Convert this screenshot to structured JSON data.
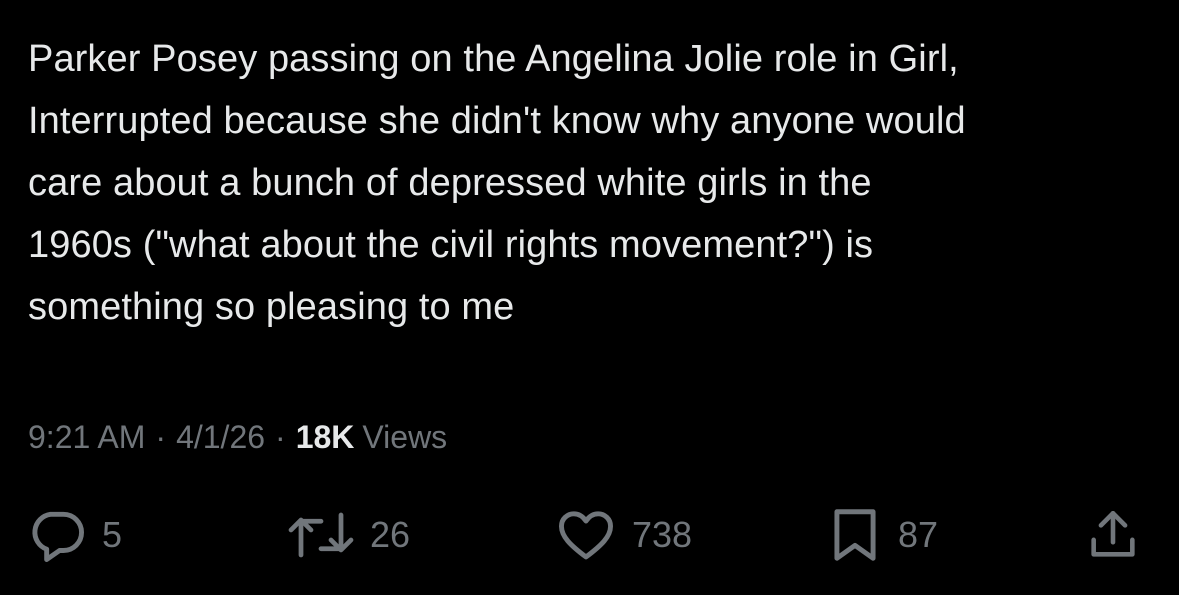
{
  "tweet": {
    "lines": [
      "Parker Posey passing on the Angelina Jolie role in Girl,",
      "Interrupted because she didn't know why anyone would",
      "care about a bunch of depressed white girls in the",
      "1960s (\"what about the civil rights movement?\") is",
      "something so pleasing to me"
    ]
  },
  "meta": {
    "time": "9:21 AM",
    "separator": "·",
    "date": "4/1/26",
    "views_count": "18K",
    "views_label": "Views"
  },
  "actions": {
    "replies": "5",
    "retweets": "26",
    "likes": "738",
    "bookmarks": "87"
  },
  "colors": {
    "background": "#000000",
    "text": "#e7e9ea",
    "muted": "#71767b"
  },
  "icons": {
    "reply": "reply-icon",
    "retweet": "retweet-icon",
    "like": "heart-icon",
    "bookmark": "bookmark-icon",
    "share": "share-icon"
  }
}
